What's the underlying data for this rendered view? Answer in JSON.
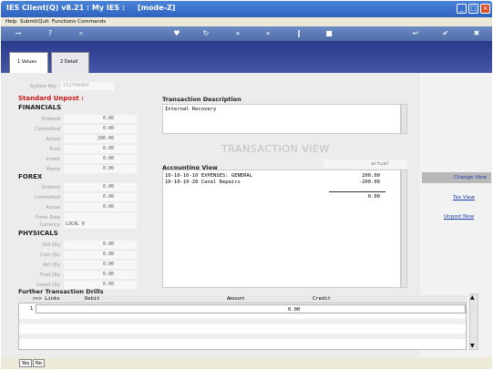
{
  "window": {
    "title": "IES Client(Q) v8.21 : My IES :     [mode-Z]"
  },
  "menu": [
    "Help",
    "Submit",
    "Quit",
    "Functions",
    "Commands"
  ],
  "tabs": [
    {
      "label": "1 Values"
    },
    {
      "label": "2 Detail"
    }
  ],
  "system_key": {
    "label": "System Key",
    "value": "152794484"
  },
  "posting": {
    "label": "Standard Unpost :"
  },
  "financials": {
    "heading": "FINANCIALS",
    "fields": [
      {
        "label": "Ordered",
        "value": "0.00"
      },
      {
        "label": "Committed",
        "value": "0.00"
      },
      {
        "label": "Actual",
        "value": "200.00"
      },
      {
        "label": "Trust",
        "value": "0.00"
      },
      {
        "label": "Invest",
        "value": "0.00"
      },
      {
        "label": "Memo",
        "value": "0.00"
      }
    ]
  },
  "forex": {
    "heading": "FOREX",
    "fields": [
      {
        "label": "Ordered",
        "value": "0.00"
      },
      {
        "label": "Committed",
        "value": "0.00"
      },
      {
        "label": "Actual",
        "value": "0.00"
      },
      {
        "label": "Forex Rate",
        "value": ""
      },
      {
        "label": "Currency",
        "value": "LOCAL R"
      }
    ]
  },
  "physicals": {
    "heading": "PHYSICALS",
    "fields": [
      {
        "label": "Ord Qty",
        "value": "0.00"
      },
      {
        "label": "Com Qty",
        "value": "0.00"
      },
      {
        "label": "Act Qty",
        "value": "0.00"
      },
      {
        "label": "Trust Qty",
        "value": "0.00"
      },
      {
        "label": "Invest Qty",
        "value": "0.00"
      }
    ]
  },
  "transaction": {
    "description_label": "Transaction Description",
    "description": "Internal Recovery",
    "view_title": "TRANSACTION VIEW",
    "accounting_label": "Accounting View",
    "mode": "actual",
    "rows": [
      {
        "account": "10-10-10-10 EXPENSES: GENERAL",
        "amount": "200.00"
      },
      {
        "account": "10-10-10-20 Canal Repairs",
        "amount": "-200.00"
      }
    ],
    "total": "0.00"
  },
  "side_links": {
    "change_view": "Change View",
    "tax_view": "Tax View",
    "unpost_now": "Unpost Now"
  },
  "drills": {
    "title": "Further Transaction Drills",
    "columns": [
      ">>> Links",
      "Debit",
      "Amount",
      "Credit"
    ],
    "row_index": "1",
    "row_amount": "0.00"
  },
  "footer": {
    "yes": "Yes",
    "no": "No"
  },
  "colors": {
    "titlebar": "#2f62c0",
    "tabstrip": "#2a3a8c",
    "accent_red": "#d01818",
    "link": "#1a3aa8"
  }
}
